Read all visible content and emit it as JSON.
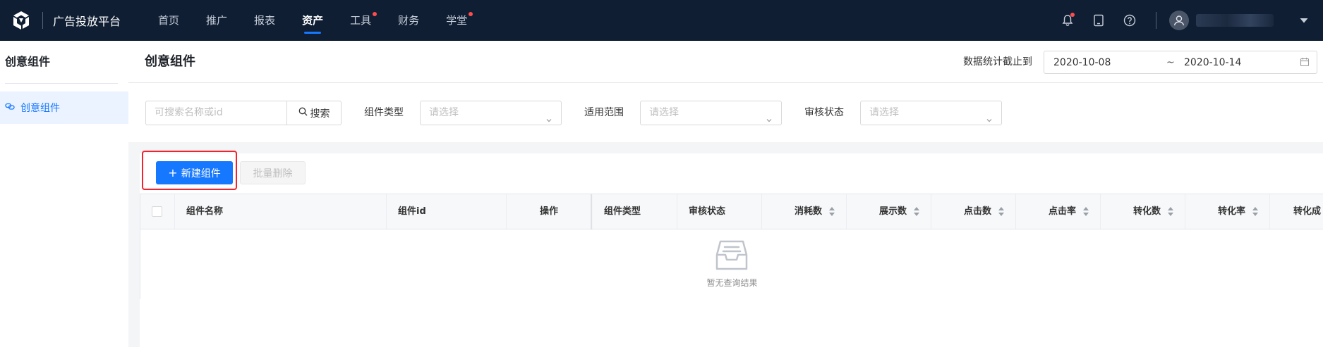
{
  "topbar": {
    "platform_name": "广告投放平台",
    "nav": [
      {
        "label": "首页",
        "active": false,
        "dot": false
      },
      {
        "label": "推广",
        "active": false,
        "dot": false
      },
      {
        "label": "报表",
        "active": false,
        "dot": false
      },
      {
        "label": "资产",
        "active": true,
        "dot": false
      },
      {
        "label": "工具",
        "active": false,
        "dot": true
      },
      {
        "label": "财务",
        "active": false,
        "dot": false
      },
      {
        "label": "学堂",
        "active": false,
        "dot": true
      }
    ],
    "icons": [
      "bell-icon",
      "tablet-icon",
      "help-icon",
      "user-avatar-icon",
      "caret-down-icon"
    ]
  },
  "sidebar": {
    "title": "创意组件",
    "items": [
      {
        "label": "创意组件",
        "icon": "link-icon",
        "active": true
      }
    ]
  },
  "header": {
    "title": "创意组件",
    "date_label": "数据统计截止到",
    "date_start": "2020-10-08",
    "date_separator": "~",
    "date_end": "2020-10-14"
  },
  "filters": {
    "search_placeholder": "可搜索名称或id",
    "search_button": "搜索",
    "type_label": "组件类型",
    "type_placeholder": "请选择",
    "scope_label": "适用范围",
    "scope_placeholder": "请选择",
    "audit_label": "审核状态",
    "audit_placeholder": "请选择"
  },
  "actions": {
    "new_label": "新建组件",
    "batch_delete_label": "批量删除"
  },
  "table": {
    "columns": [
      "组件名称",
      "组件id",
      "操作",
      "组件类型",
      "审核状态",
      "消耗数",
      "展示数",
      "点击数",
      "点击率",
      "转化数",
      "转化率",
      "转化成"
    ],
    "empty_text": "暂无查询结果"
  },
  "colors": {
    "topbar_bg": "#0f1e33",
    "primary": "#1677ff",
    "highlight_border": "#f5222d",
    "nav_dot": "#ff4d4f"
  }
}
